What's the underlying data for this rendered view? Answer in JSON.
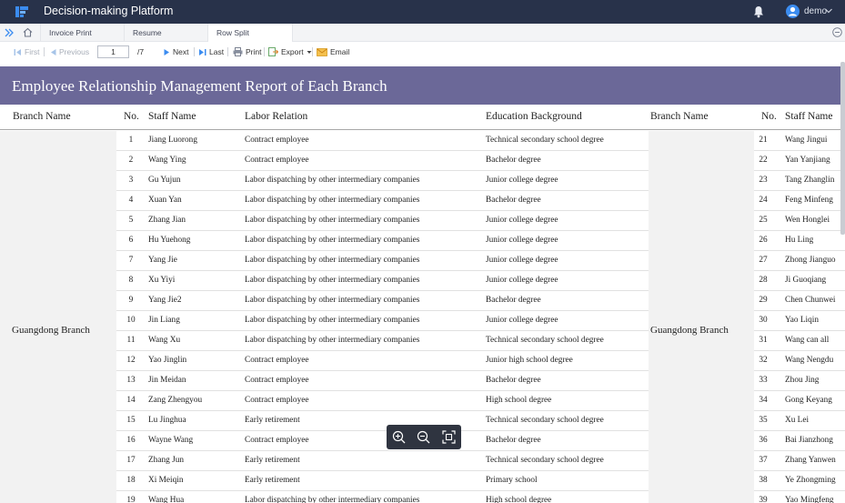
{
  "app": {
    "title": "Decision-making Platform",
    "user": "demo"
  },
  "tabs": [
    {
      "label": "Invoice Print"
    },
    {
      "label": "Resume"
    },
    {
      "label": "Row Split",
      "active": true
    }
  ],
  "toolbar": {
    "first": "First",
    "previous": "Previous",
    "page_value": "1",
    "page_total": "/7",
    "next": "Next",
    "last": "Last",
    "print": "Print",
    "export": "Export",
    "email": "Email"
  },
  "report": {
    "title": "Employee Relationship Management Report of Each Branch",
    "headers": {
      "branch": "Branch Name",
      "no": "No.",
      "staff": "Staff Name",
      "labor": "Labor Relation",
      "education": "Education Background"
    },
    "branch_name": "Guangdong Branch",
    "left_rows": [
      {
        "no": "1",
        "name": "Jiang Luorong",
        "labor": "Contract employee",
        "edu": "Technical secondary school degree"
      },
      {
        "no": "2",
        "name": "Wang Ying",
        "labor": "Contract employee",
        "edu": "Bachelor degree"
      },
      {
        "no": "3",
        "name": "Gu Yujun",
        "labor": "Labor dispatching by other intermediary companies",
        "edu": "Junior college degree"
      },
      {
        "no": "4",
        "name": "Xuan Yan",
        "labor": "Labor dispatching by other intermediary companies",
        "edu": "Bachelor degree"
      },
      {
        "no": "5",
        "name": "Zhang Jian",
        "labor": "Labor dispatching by other intermediary companies",
        "edu": "Junior college degree"
      },
      {
        "no": "6",
        "name": "Hu Yuehong",
        "labor": "Labor dispatching by other intermediary companies",
        "edu": "Junior college degree"
      },
      {
        "no": "7",
        "name": "Yang Jie",
        "labor": "Labor dispatching by other intermediary companies",
        "edu": "Junior college degree"
      },
      {
        "no": "8",
        "name": "Xu Yiyi",
        "labor": "Labor dispatching by other intermediary companies",
        "edu": "Junior college degree"
      },
      {
        "no": "9",
        "name": "Yang Jie2",
        "labor": "Labor dispatching by other intermediary companies",
        "edu": "Bachelor degree"
      },
      {
        "no": "10",
        "name": "Jin Liang",
        "labor": "Labor dispatching by other intermediary companies",
        "edu": "Junior college degree"
      },
      {
        "no": "11",
        "name": "Wang Xu",
        "labor": "Labor dispatching by other intermediary companies",
        "edu": "Technical secondary school degree"
      },
      {
        "no": "12",
        "name": "Yao Jinglin",
        "labor": "Contract employee",
        "edu": "Junior high school degree"
      },
      {
        "no": "13",
        "name": "Jin Meidan",
        "labor": "Contract employee",
        "edu": "Bachelor degree"
      },
      {
        "no": "14",
        "name": "Zang Zhengyou",
        "labor": "Contract employee",
        "edu": "High school degree"
      },
      {
        "no": "15",
        "name": "Lu Jinghua",
        "labor": "Early retirement",
        "edu": "Technical secondary school degree"
      },
      {
        "no": "16",
        "name": "Wayne Wang",
        "labor": "Contract employee",
        "edu": "Bachelor degree"
      },
      {
        "no": "17",
        "name": "Zhang Jun",
        "labor": "Early retirement",
        "edu": "Technical secondary school degree"
      },
      {
        "no": "18",
        "name": "Xi Meiqin",
        "labor": "Early retirement",
        "edu": "Primary school"
      },
      {
        "no": "19",
        "name": "Wang Hua",
        "labor": "Labor dispatching by other intermediary companies",
        "edu": "High school degree"
      }
    ],
    "right_rows": [
      {
        "no": "21",
        "name": "Wang Jingui"
      },
      {
        "no": "22",
        "name": "Yan Yanjiang"
      },
      {
        "no": "23",
        "name": "Tang Zhanglin"
      },
      {
        "no": "24",
        "name": "Feng Minfeng"
      },
      {
        "no": "25",
        "name": "Wen Honglei"
      },
      {
        "no": "26",
        "name": "Hu Ling"
      },
      {
        "no": "27",
        "name": "Zhong Jianguo"
      },
      {
        "no": "28",
        "name": "Ji Guoqiang"
      },
      {
        "no": "29",
        "name": "Chen Chunwei"
      },
      {
        "no": "30",
        "name": "Yao Liqin"
      },
      {
        "no": "31",
        "name": "Wang can all"
      },
      {
        "no": "32",
        "name": "Wang Nengdu"
      },
      {
        "no": "33",
        "name": "Zhou Jing"
      },
      {
        "no": "34",
        "name": "Gong Keyang"
      },
      {
        "no": "35",
        "name": "Xu Lei"
      },
      {
        "no": "36",
        "name": "Bai Jianzhong"
      },
      {
        "no": "37",
        "name": "Zhang Yanwen"
      },
      {
        "no": "38",
        "name": "Ye Zhongming"
      },
      {
        "no": "39",
        "name": "Yao Mingfeng"
      }
    ]
  },
  "colors": {
    "topbar": "#28324a",
    "title_band": "#6b6898",
    "accent": "#3b8cf0"
  }
}
